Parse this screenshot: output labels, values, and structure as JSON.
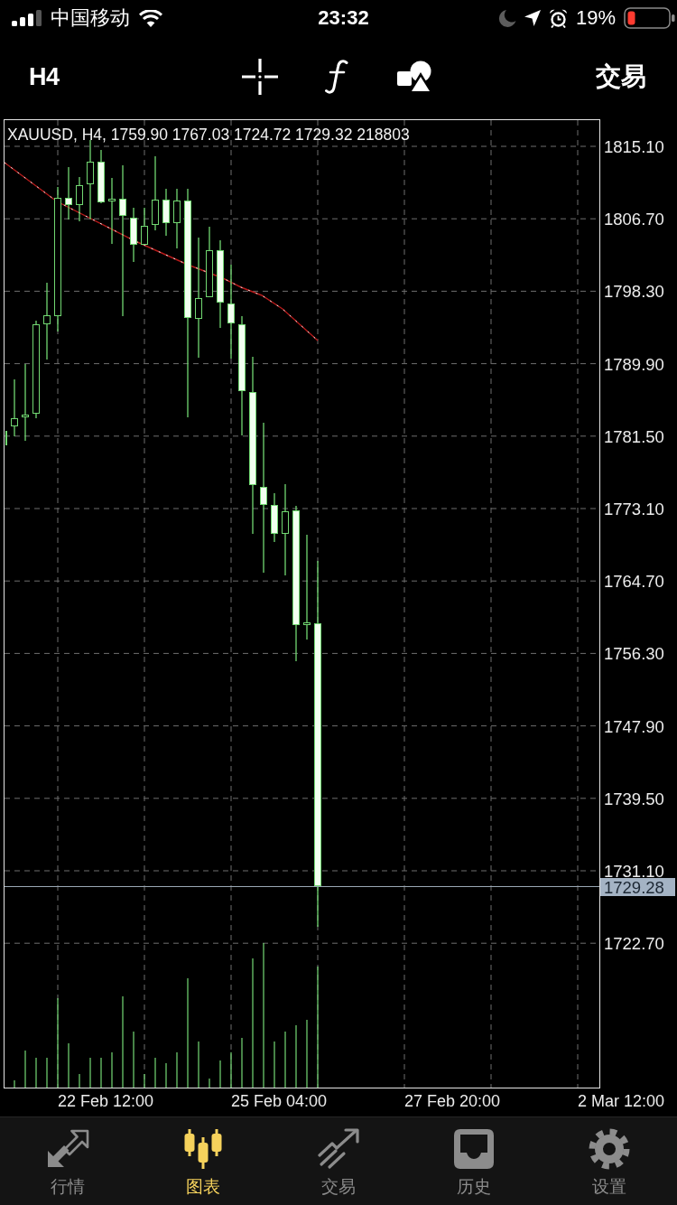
{
  "status_bar": {
    "carrier": "中国移动",
    "time": "23:32",
    "battery": "19%"
  },
  "toolbar": {
    "timeframe": "H4",
    "trade_button": "交易"
  },
  "chart": {
    "header": "XAUUSD, H4, 1759.90 1767.03 1724.72 1729.32 218803",
    "price_labels": [
      "1815.10",
      "1806.70",
      "1798.30",
      "1789.90",
      "1781.50",
      "1773.10",
      "1764.70",
      "1756.30",
      "1747.90",
      "1739.50",
      "1731.10",
      "1722.70"
    ],
    "current_price": "1729.28",
    "time_labels": [
      "22 Feb 12:00",
      "25 Feb 04:00",
      "27 Feb 20:00",
      "2 Mar 12:00"
    ]
  },
  "tab_bar": {
    "items": [
      {
        "label": "行情",
        "selected": false
      },
      {
        "label": "图表",
        "selected": true
      },
      {
        "label": "交易",
        "selected": false
      },
      {
        "label": "历史",
        "selected": false
      },
      {
        "label": "设置",
        "selected": false
      }
    ]
  }
}
